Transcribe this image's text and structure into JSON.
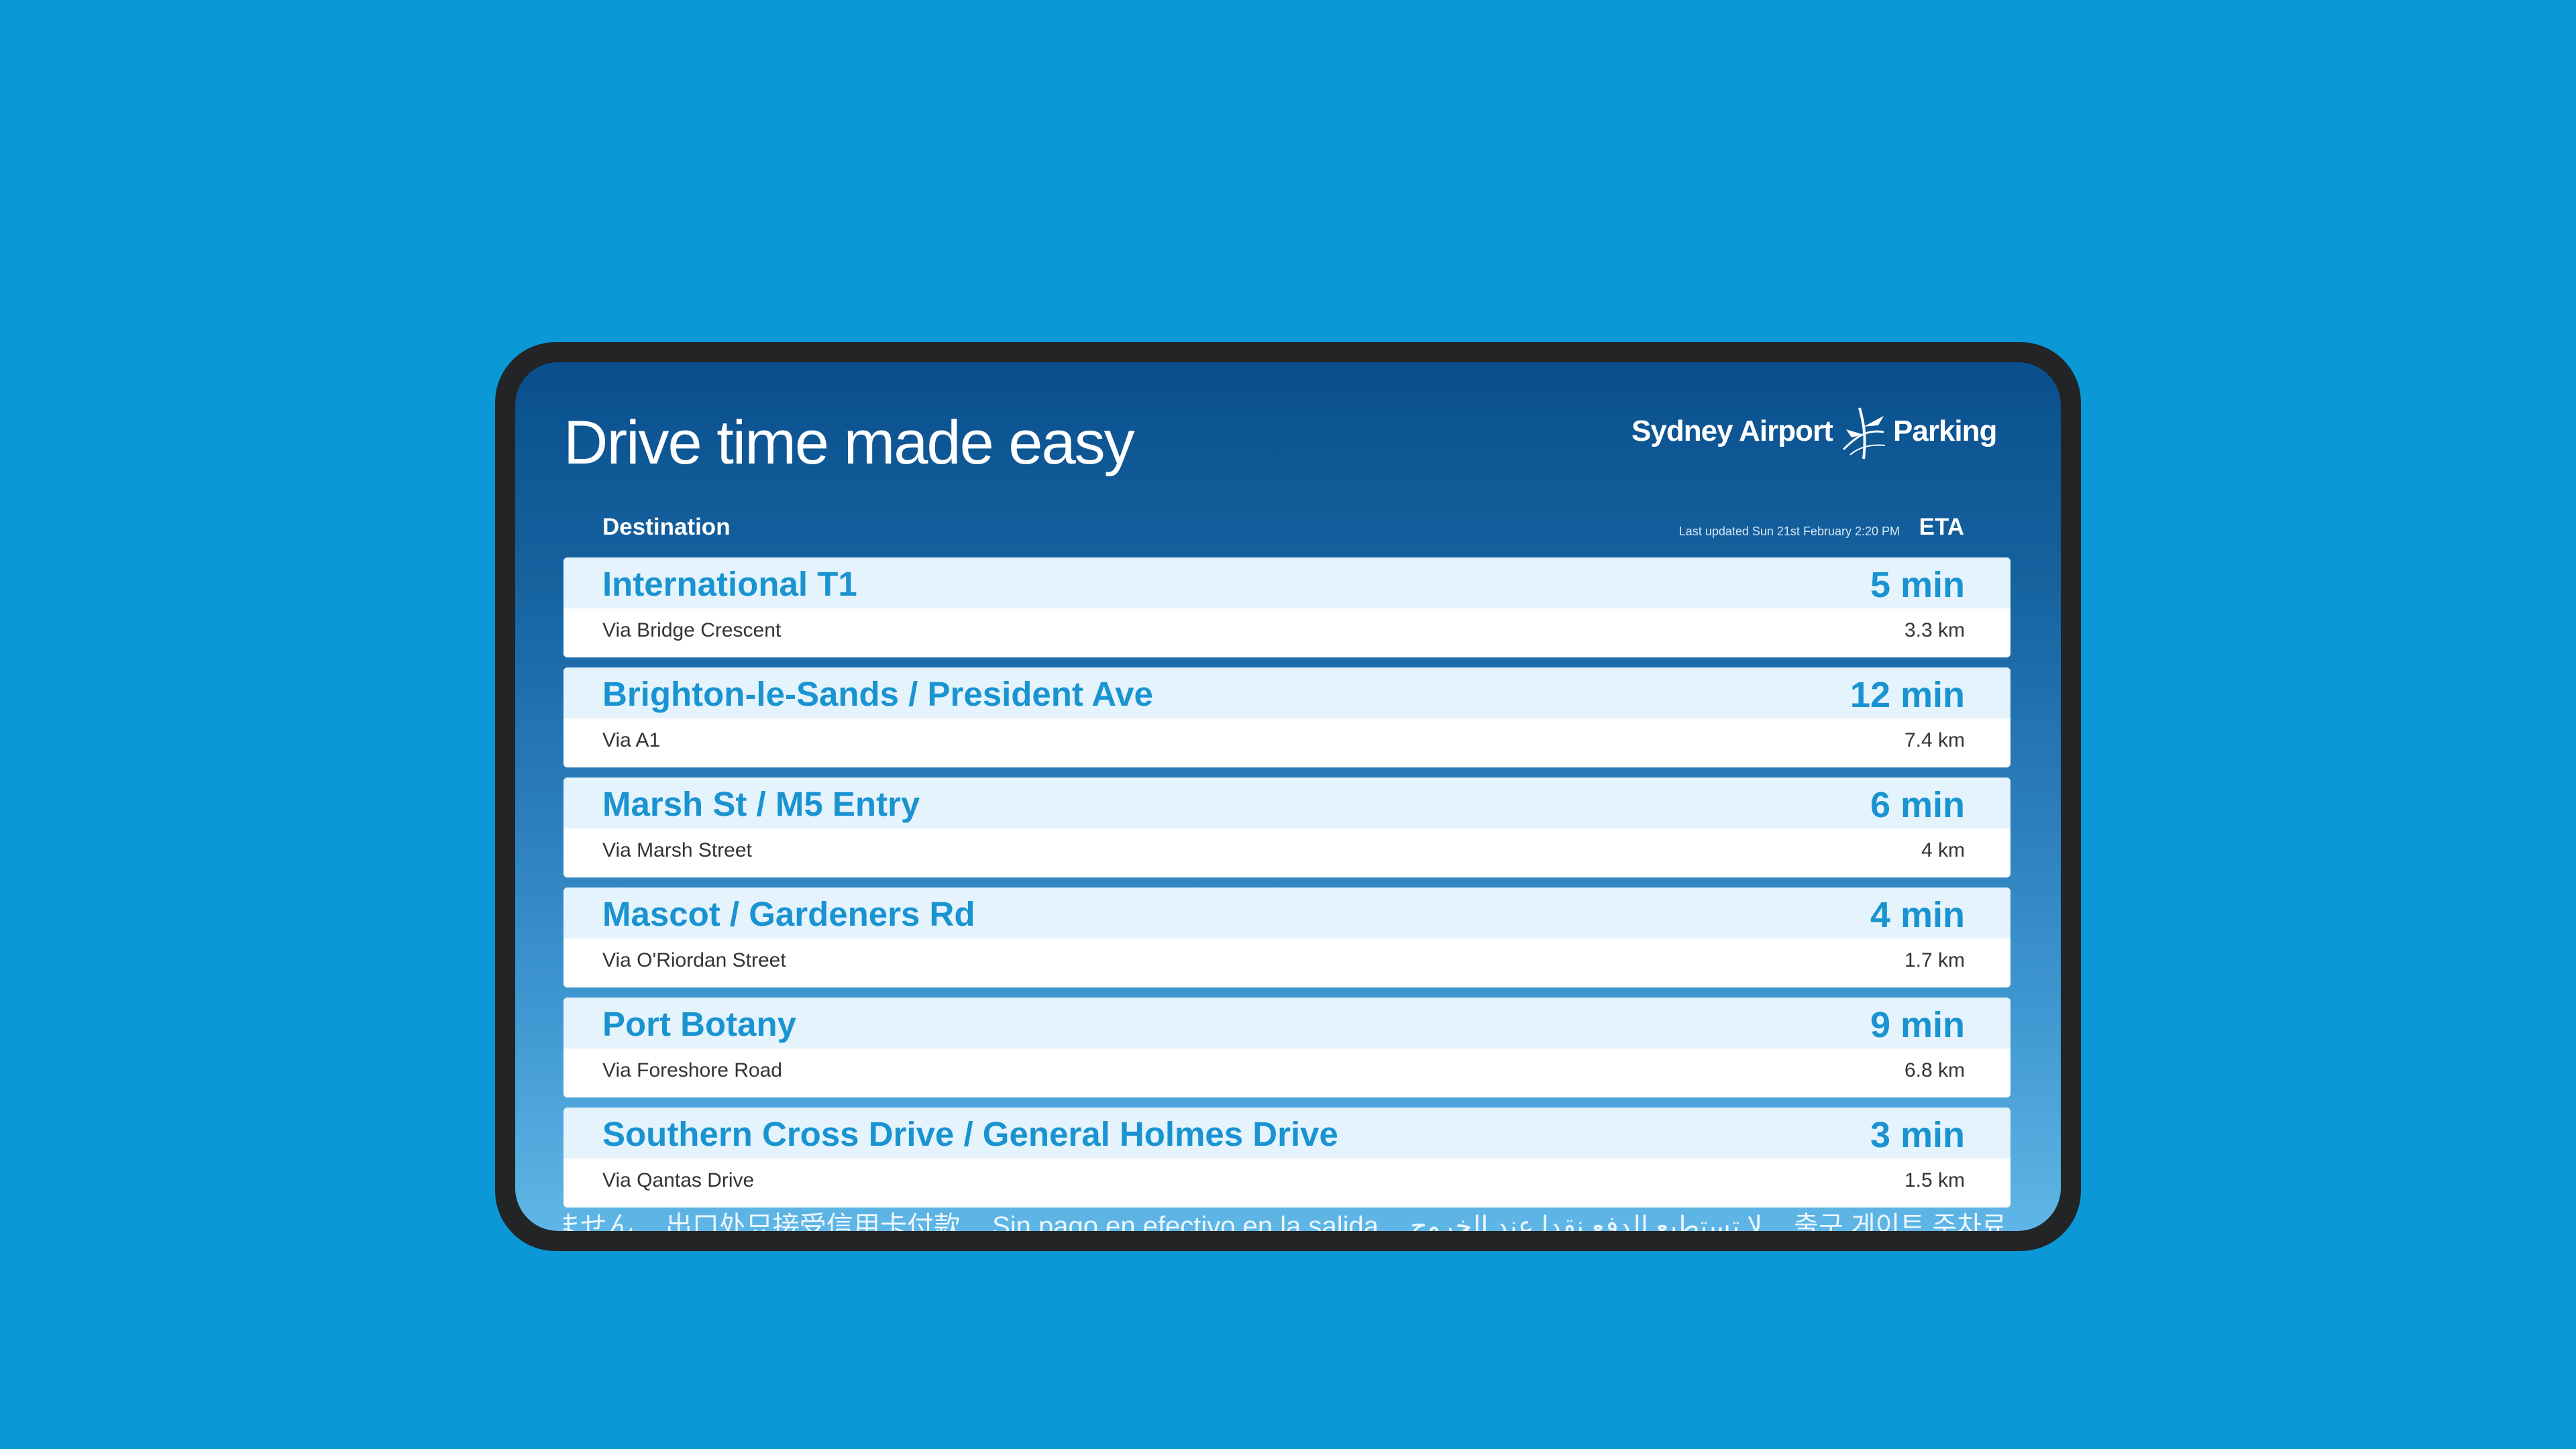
{
  "sign": {
    "title": "Drive time made easy",
    "logo": {
      "brand": "Sydney Airport",
      "product": "Parking",
      "mark_icon": "plane-swirl-icon"
    }
  },
  "table": {
    "destination_header": "Destination",
    "last_updated": "Last updated Sun 21st February 2:20 PM",
    "eta_header": "ETA",
    "rows": [
      {
        "destination": "International T1",
        "eta": "5 min",
        "via": "Via Bridge Crescent",
        "distance": "3.3 km"
      },
      {
        "destination": "Brighton-le-Sands / President Ave",
        "eta": "12 min",
        "via": "Via A1",
        "distance": "7.4 km"
      },
      {
        "destination": "Marsh St / M5 Entry",
        "eta": "6 min",
        "via": "Via Marsh Street",
        "distance": "4 km"
      },
      {
        "destination": "Mascot / Gardeners Rd",
        "eta": "4 min",
        "via": "Via O'Riordan Street",
        "distance": "1.7 km"
      },
      {
        "destination": "Port Botany",
        "eta": "9 min",
        "via": "Via Foreshore Road",
        "distance": "6.8 km"
      },
      {
        "destination": "Southern Cross Drive / General Holmes Drive",
        "eta": "3 min",
        "via": "Via Qantas Drive",
        "distance": "1.5 km"
      }
    ]
  },
  "ticker": {
    "items": [
      "ません",
      "出口处只接受信用卡付款",
      "Sin pago en efectivo en la salida",
      "لا تستطيع الدفع نقدا عند الخروج",
      "출구 게이트 주차료 현금 지급 불"
    ]
  },
  "colors": {
    "background": "#0b98d6",
    "bezel": "#222426",
    "accent_text": "#1a93d1",
    "row_top": "#e4f3fc"
  }
}
